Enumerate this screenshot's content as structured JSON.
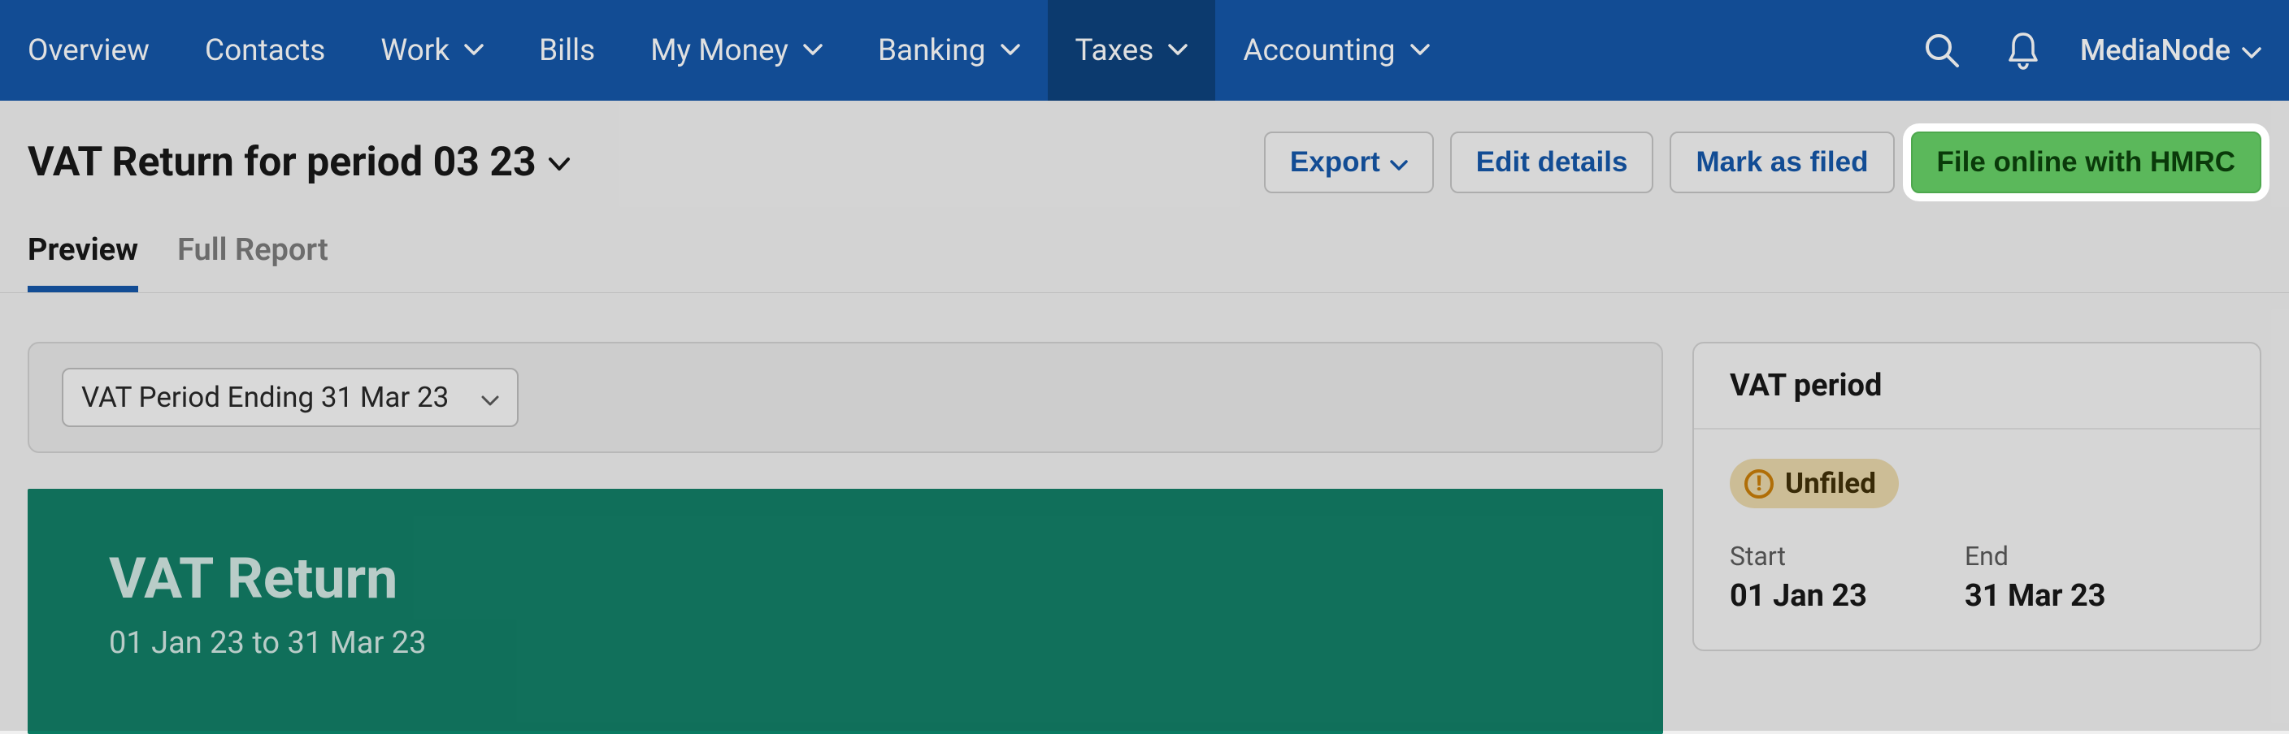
{
  "nav": {
    "items": [
      {
        "label": "Overview",
        "has_menu": false
      },
      {
        "label": "Contacts",
        "has_menu": false
      },
      {
        "label": "Work",
        "has_menu": true
      },
      {
        "label": "Bills",
        "has_menu": false
      },
      {
        "label": "My Money",
        "has_menu": true
      },
      {
        "label": "Banking",
        "has_menu": true
      },
      {
        "label": "Taxes",
        "has_menu": true,
        "active": true
      },
      {
        "label": "Accounting",
        "has_menu": true
      }
    ],
    "account_name": "MediaNode"
  },
  "page": {
    "title": "VAT Return for period 03 23"
  },
  "actions": {
    "export": "Export",
    "edit_details": "Edit details",
    "mark_as_filed": "Mark as filed",
    "file_online": "File online with HMRC"
  },
  "tabs": [
    {
      "label": "Preview",
      "active": true
    },
    {
      "label": "Full Report",
      "active": false
    }
  ],
  "period_select": {
    "value": "VAT Period Ending 31 Mar 23"
  },
  "banner": {
    "heading": "VAT Return",
    "date_range": "01 Jan 23 to 31 Mar 23"
  },
  "side_panel": {
    "title": "VAT period",
    "status": "Unfiled",
    "start_label": "Start",
    "start_value": "01 Jan 23",
    "end_label": "End",
    "end_value": "31 Mar 23"
  }
}
